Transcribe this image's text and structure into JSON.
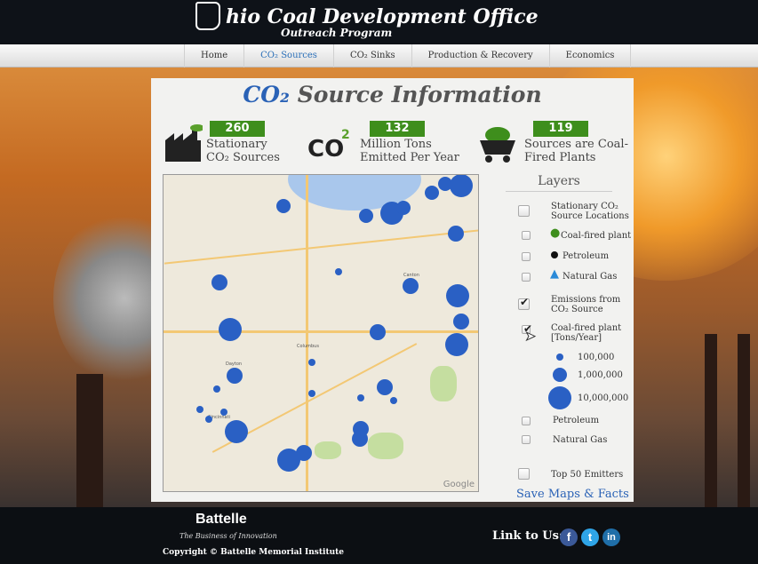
{
  "header": {
    "title": "hio Coal Development Office",
    "subtitle": "Outreach Program"
  },
  "nav": {
    "items": [
      {
        "label": "Home"
      },
      {
        "label": "CO₂ Sources"
      },
      {
        "label": "CO₂ Sinks"
      },
      {
        "label": "Production & Recovery"
      },
      {
        "label": "Economics"
      }
    ],
    "active_index": 1
  },
  "panel": {
    "title_co2": "CO₂",
    "title_rest": " Source Information",
    "stats": [
      {
        "value": "260",
        "line1": "Stationary",
        "line2": "CO₂ Sources",
        "icon": "factory-icon"
      },
      {
        "value": "132",
        "line1": "Million Tons",
        "line2": "Emitted Per Year",
        "icon": "co2-icon"
      },
      {
        "value": "119",
        "line1": "Sources are Coal-",
        "line2": "Fired Plants",
        "icon": "coal-cart-icon"
      }
    ]
  },
  "layers": {
    "heading": "Layers",
    "group1_line1": "Stationary CO₂",
    "group1_line2": "Source Locations",
    "coal_fired": "Coal-fired plant",
    "petroleum": "Petroleum",
    "natural_gas": "Natural Gas",
    "group2_line1": "Emissions from",
    "group2_line2": "CO₂ Source",
    "coal_plant_tons_line1": "Coal-fired plant",
    "coal_plant_tons_line2": "[Tons/Year]",
    "legend_small": "100,000",
    "legend_medium": "1,000,000",
    "legend_large": "10,000,000",
    "petroleum2": "Petroleum",
    "natural_gas2": "Natural Gas",
    "top50": "Top 50 Emitters",
    "checked": {
      "emissions": true,
      "coal_plant_tons": true
    }
  },
  "map": {
    "google_label": "Google"
  },
  "save_link": "Save Maps & Facts",
  "footer": {
    "brand": "Battelle",
    "tagline": "The Business of Innovation",
    "copyright": "Copyright © Battelle Memorial Institute",
    "link_label": "Link to Us:"
  },
  "colors": {
    "accent_blue": "#2a62b6",
    "stat_green": "#3e8e1c",
    "bubble_blue": "#2a60c4"
  }
}
